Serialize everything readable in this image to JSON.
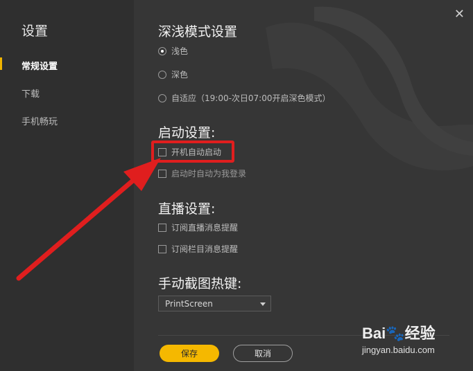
{
  "sidebar": {
    "title": "设置",
    "items": [
      {
        "label": "常规设置",
        "active": true
      },
      {
        "label": "下载"
      },
      {
        "label": "手机畅玩"
      }
    ]
  },
  "close_icon": "close-icon",
  "theme": {
    "title": "深浅模式设置",
    "options": [
      {
        "label": "浅色",
        "checked": true
      },
      {
        "label": "深色",
        "checked": false
      },
      {
        "label": "自适应（19:00-次日07:00开启深色模式）",
        "checked": false
      }
    ]
  },
  "startup": {
    "title": "启动设置:",
    "options": [
      {
        "label": "开机自动启动",
        "checked": false
      },
      {
        "label": "启动时自动为我登录",
        "checked": false
      }
    ]
  },
  "live": {
    "title": "直播设置:",
    "options": [
      {
        "label": "订阅直播消息提醒",
        "checked": false
      },
      {
        "label": "订阅栏目消息提醒",
        "checked": false
      }
    ]
  },
  "screenshot": {
    "title": "手动截图热键:",
    "hotkey": "PrintScreen"
  },
  "footer": {
    "save": "保存",
    "cancel": "取消"
  },
  "watermark": {
    "logo": "Bai🐾经验",
    "url": "jingyan.baidu.com"
  },
  "colors": {
    "accent": "#f5b800",
    "highlight": "#e01e1e"
  }
}
